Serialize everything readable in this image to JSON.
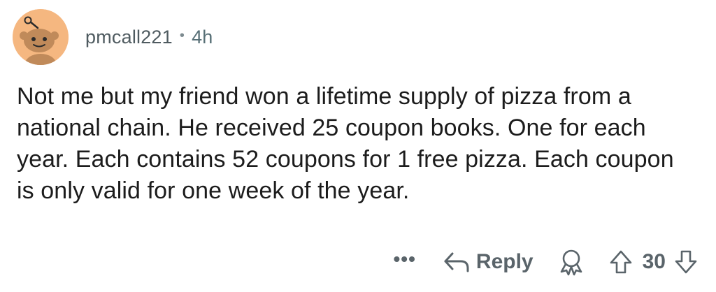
{
  "comment": {
    "author": "pmcall221",
    "separator": "•",
    "time": "4h",
    "avatar": "snoo-avatar",
    "avatar_color": "#f5b780",
    "body": "Not me but my friend won a lifetime supply of pizza from a national chain. He received 25 coupon books. One for each year. Each contains 52 coupons for 1 free pizza. Each coupon is only valid for one week of the year."
  },
  "actions": {
    "more_label": "•••",
    "reply_icon": "reply-arrow-icon",
    "reply_label": "Reply",
    "award_icon": "award-icon",
    "upvote_icon": "upvote-icon",
    "score": "30",
    "downvote_icon": "downvote-icon"
  }
}
